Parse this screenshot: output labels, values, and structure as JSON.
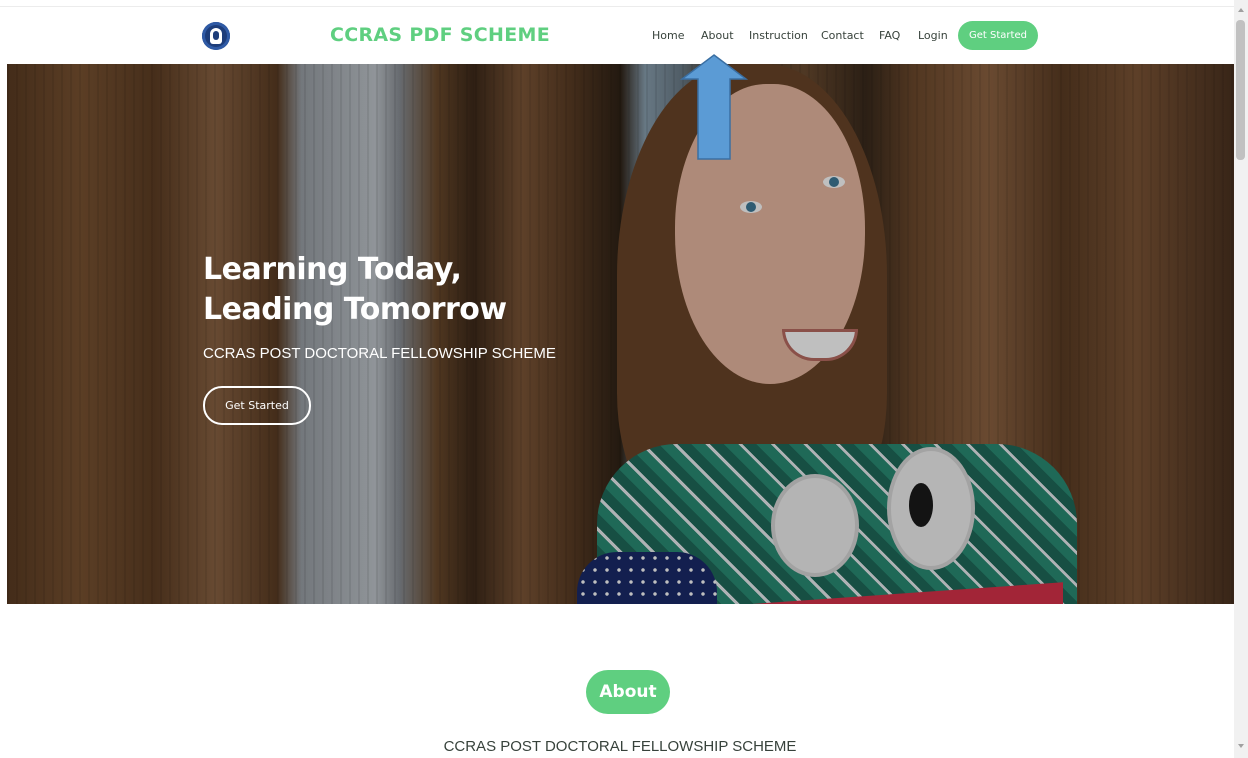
{
  "header": {
    "brand": "CCRAS PDF SCHEME",
    "nav": [
      "Home",
      "About",
      "Instruction",
      "Contact",
      "FAQ",
      "Login"
    ],
    "cta_label": "Get Started"
  },
  "hero": {
    "title_line1": "Learning Today,",
    "title_line2": "Leading Tomorrow",
    "subtitle": "CCRAS POST DOCTORAL FELLOWSHIP SCHEME",
    "button_label": "Get Started"
  },
  "about": {
    "badge": "About",
    "subtitle": "CCRAS POST DOCTORAL FELLOWSHIP SCHEME"
  },
  "colors": {
    "accent": "#5fcf80",
    "text": "#37423b",
    "arrow": "#5b9bd5"
  },
  "icons": {
    "logo": "ccras-emblem-icon",
    "annotation": "up-arrow-icon"
  }
}
